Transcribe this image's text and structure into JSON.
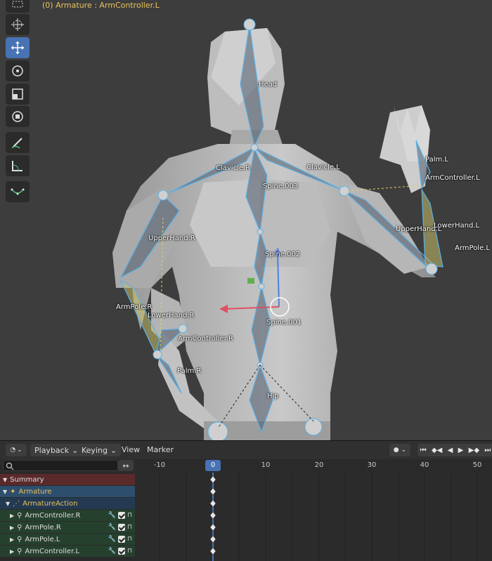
{
  "viewport": {
    "header_text": "(0) Armature : ArmController.L",
    "tools": [
      "select-box-icon",
      "cursor-icon",
      "move-icon",
      "rotate-icon",
      "scale-icon",
      "transform-icon",
      "annotate-icon",
      "measure-icon",
      "bone-roll-icon"
    ],
    "active_tool": "move-icon",
    "bones": [
      {
        "name": "Head"
      },
      {
        "name": "Palm.L"
      },
      {
        "name": "Clavicle.R"
      },
      {
        "name": "Clavicle.L"
      },
      {
        "name": "ArmController.L"
      },
      {
        "name": "Spine.003"
      },
      {
        "name": "UpperHand.R"
      },
      {
        "name": "UpperHand.L"
      },
      {
        "name": "LowerHand.L"
      },
      {
        "name": "ArmPole.L"
      },
      {
        "name": "Spine.002"
      },
      {
        "name": "ArmPole.R"
      },
      {
        "name": "LowerHand.R"
      },
      {
        "name": "Spine.001"
      },
      {
        "name": "ArmController.R"
      },
      {
        "name": "Palm.R"
      },
      {
        "name": "Hip"
      }
    ]
  },
  "timeline": {
    "menus": {
      "playback": "Playback",
      "keying": "Keying",
      "view": "View",
      "marker": "Marker"
    },
    "search_placeholder": "",
    "current_frame": "0",
    "ticks": [
      "-10",
      "10",
      "20",
      "30",
      "40",
      "50"
    ],
    "channels": {
      "summary": "Summary",
      "armature": "Armature",
      "action": "ArmatureAction",
      "bones": [
        "ArmController.R",
        "ArmPole.R",
        "ArmPole.L",
        "ArmController.L"
      ]
    }
  },
  "colors": {
    "accent": "#4772b3",
    "bone_outline": "#5ab0e6",
    "header_text": "#e8c35a",
    "summary_row": "#5a2a2a",
    "armature_row": "#2e4e6e",
    "bone_row": "#26402e"
  }
}
